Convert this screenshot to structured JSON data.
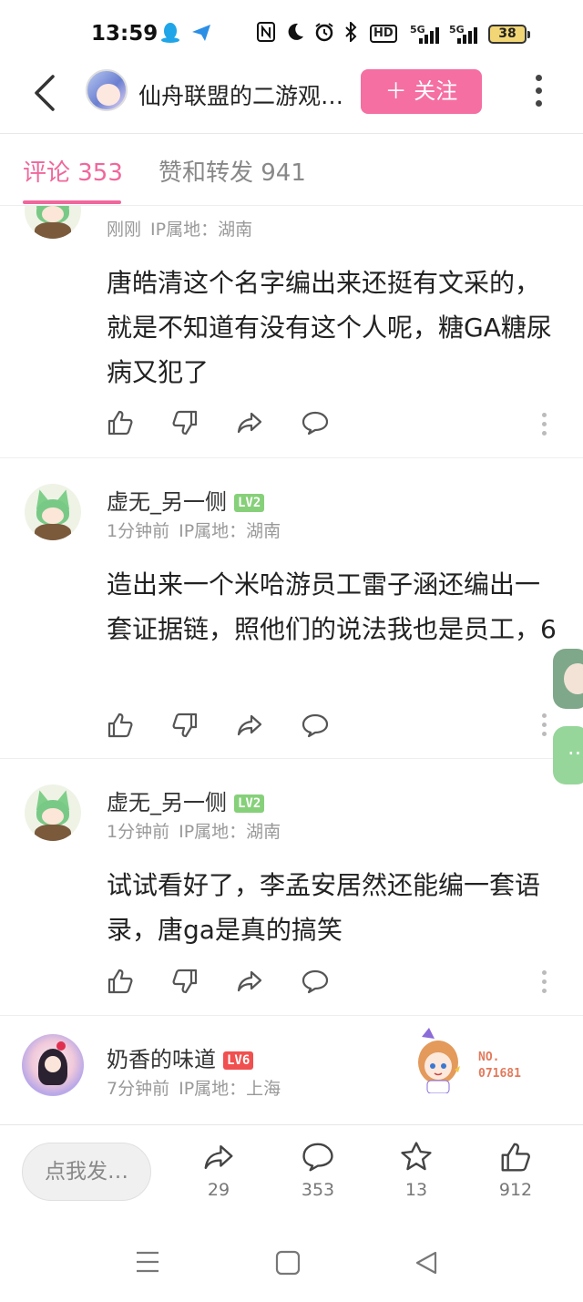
{
  "status_bar": {
    "time": "13:59",
    "hd_label": "HD",
    "signal1": "5G",
    "signal2": "5G",
    "battery": "38"
  },
  "header": {
    "title": "仙舟联盟的二游观…",
    "follow_label": "＋ 关注"
  },
  "tabs": [
    {
      "label": "评论 353",
      "active": true
    },
    {
      "label": "赞和转发 941",
      "active": false
    }
  ],
  "comments": [
    {
      "name": "",
      "level": "",
      "time": "刚刚",
      "ip": "IP属地：湖南",
      "text": "唐皓清这个名字编出来还挺有文采的，就是不知道有没有这个人呢，糖GA糖尿病又犯了"
    },
    {
      "name": "虚无_另一侧",
      "level": "LV2",
      "time": "1分钟前",
      "ip": "IP属地：湖南",
      "text": "造出来一个米哈游员工雷子涵还编出一套证据链，照他们的说法我也是员工，6"
    },
    {
      "name": "虚无_另一侧",
      "level": "LV2",
      "time": "1分钟前",
      "ip": "IP属地：湖南",
      "text": "试试看好了，李孟安居然还能编一套语录，唐ga是真的搞笑"
    },
    {
      "name": "奶香的味道",
      "level": "LV6",
      "time": "7分钟前",
      "ip": "IP属地：上海",
      "text": ""
    }
  ],
  "badge_deco": {
    "line1": "NO.",
    "line2": "071681"
  },
  "bottom_bar": {
    "input_placeholder": "点我发…",
    "share_count": "29",
    "comment_count": "353",
    "favorite_count": "13",
    "like_count": "912"
  },
  "colors": {
    "accent": "#f0679c",
    "follow_bg": "#f56fa2",
    "lv2": "#86d07a",
    "lv6": "#f0504f"
  }
}
